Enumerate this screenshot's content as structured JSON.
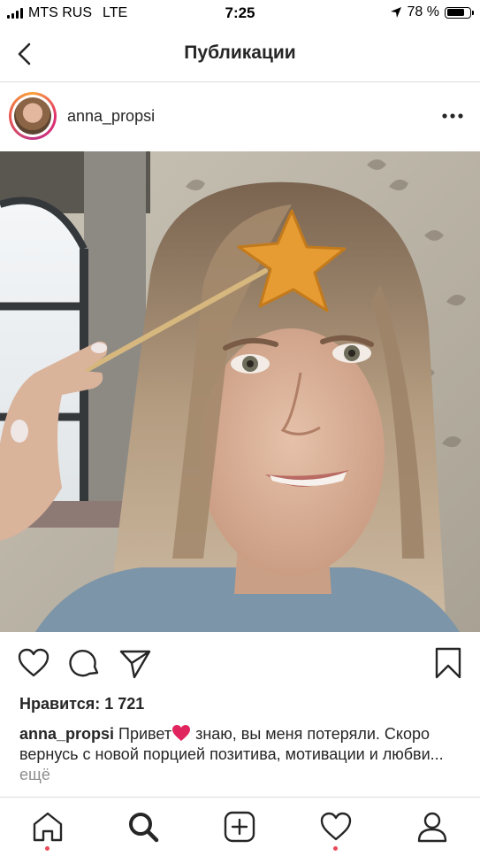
{
  "status_bar": {
    "carrier": "MTS RUS",
    "network": "LTE",
    "time": "7:25",
    "battery": "78 %",
    "battery_level": 0.78
  },
  "nav": {
    "title": "Публикации",
    "back_icon": "chevron-left-icon"
  },
  "post": {
    "username": "anna_propsi",
    "more_icon": "ellipsis-icon",
    "photo_alt": "",
    "likes": "Нравится: 1 721",
    "caption_user": "anna_propsi",
    "caption_before_emoji": "Привет",
    "caption_after_emoji": " знаю, вы меня потеряли. Скоро вернусь с новой порцией позитива, мотивации и любви...",
    "caption_more": "ещё",
    "emoji_color": "#e0245e"
  },
  "actions": {
    "like_icon": "heart-outline-icon",
    "comment_icon": "comment-icon",
    "share_icon": "paper-plane-icon",
    "save_icon": "bookmark-icon"
  },
  "tab_bar": {
    "items": [
      {
        "name": "home",
        "icon": "home-icon",
        "notification_dot": true
      },
      {
        "name": "search",
        "icon": "search-icon",
        "notification_dot": false
      },
      {
        "name": "create",
        "icon": "plus-square-icon",
        "notification_dot": false
      },
      {
        "name": "activity",
        "icon": "heart-outline-icon",
        "notification_dot": true
      },
      {
        "name": "profile",
        "icon": "person-icon",
        "notification_dot": false
      }
    ],
    "dot_color": "#ed4956"
  }
}
